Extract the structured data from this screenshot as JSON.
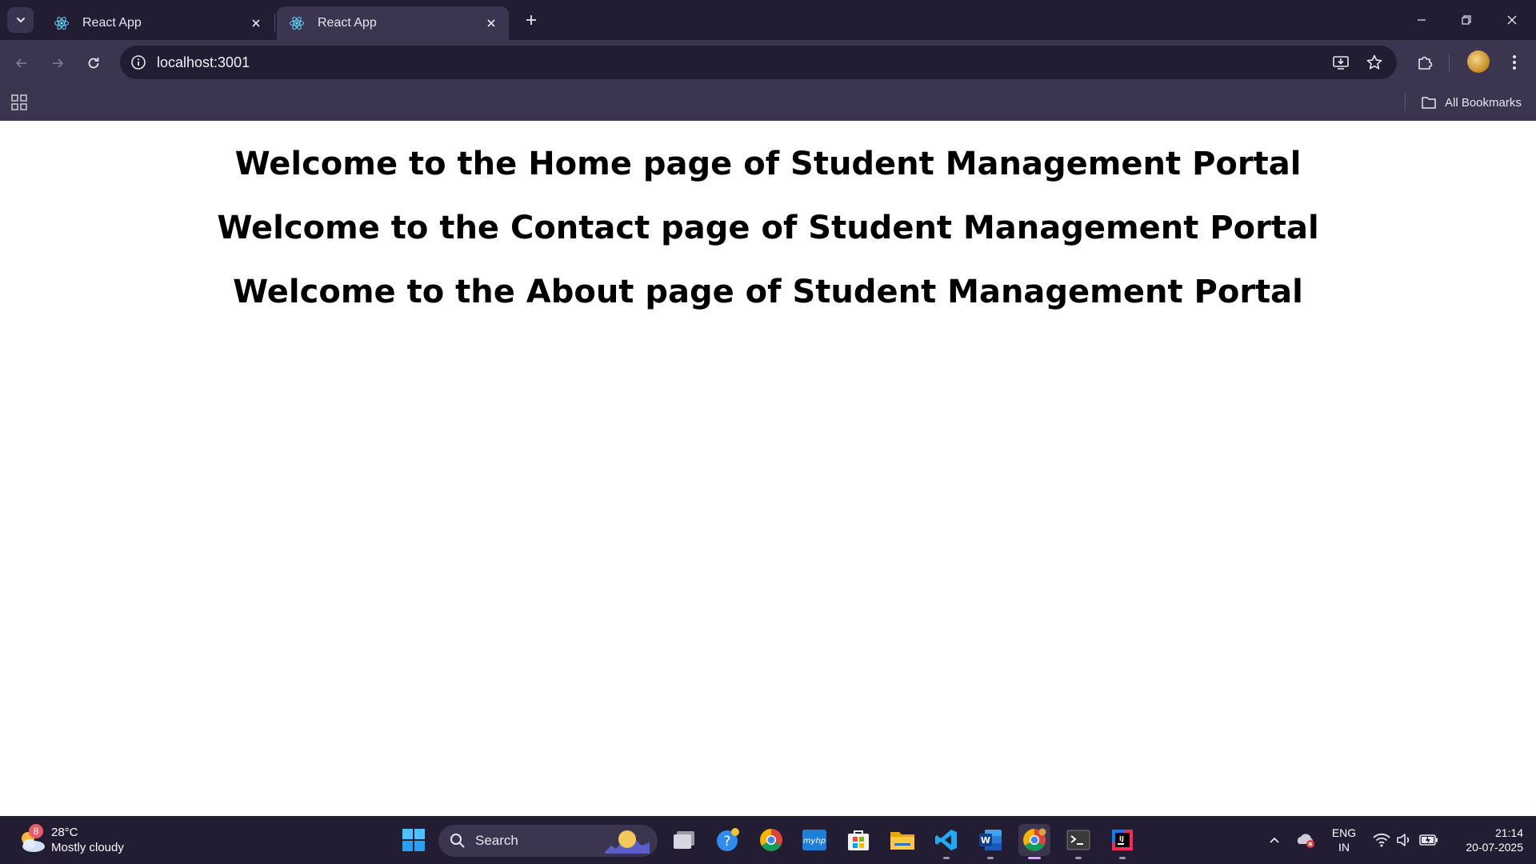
{
  "browser": {
    "tabs": [
      {
        "title": "React App",
        "active": false
      },
      {
        "title": "React App",
        "active": true
      }
    ],
    "url": "localhost:3001",
    "bookmarks_label": "All Bookmarks"
  },
  "page": {
    "headings": [
      "Welcome to the Home page of Student Management Portal",
      "Welcome to the Contact page of Student Management Portal",
      "Welcome to the About page of Student Management Portal"
    ]
  },
  "taskbar": {
    "weather": {
      "badge": "8",
      "temp": "28°C",
      "condition": "Mostly cloudy"
    },
    "search_label": "Search",
    "language": {
      "line1": "ENG",
      "line2": "IN"
    },
    "clock": {
      "time": "21:14",
      "date": "20-07-2025"
    }
  },
  "colors": {
    "tab_strip": "#221d33",
    "toolbar": "#3b3550",
    "react_icon": "#61dafb"
  }
}
